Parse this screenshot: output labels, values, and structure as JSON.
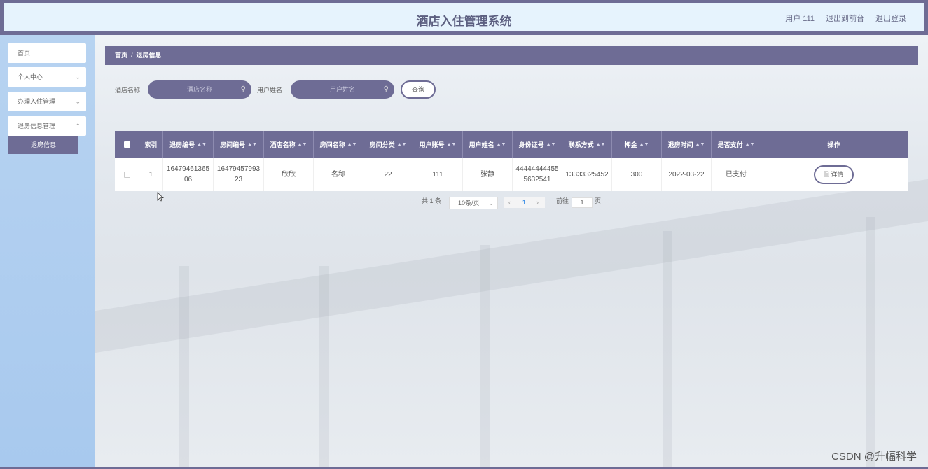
{
  "header": {
    "title": "酒店入住管理系统",
    "user": "用户 111",
    "exit_front": "退出到前台",
    "logout": "退出登录"
  },
  "sidebar": {
    "items": [
      {
        "label": "首页"
      },
      {
        "label": "个人中心"
      },
      {
        "label": "办理入住管理"
      },
      {
        "label": "退房信息管理"
      }
    ],
    "active_sub": "退房信息"
  },
  "breadcrumb": {
    "home": "首页",
    "sep": "/",
    "current": "退房信息"
  },
  "search": {
    "hotel_label": "酒店名称",
    "hotel_placeholder": "酒店名称",
    "user_label": "用户姓名",
    "user_placeholder": "用户姓名",
    "query_button": "查询"
  },
  "table": {
    "headers": [
      "索引",
      "退房编号",
      "房间编号",
      "酒店名称",
      "房间名称",
      "房间分类",
      "用户账号",
      "用户姓名",
      "身份证号",
      "联系方式",
      "押金",
      "退房时间",
      "是否支付",
      "操作"
    ],
    "rows": [
      {
        "index": "1",
        "checkout_no": "1647946136506",
        "room_no": "1647945799323",
        "hotel": "欣欣",
        "room_name": "名称",
        "room_type": "22",
        "account": "111",
        "user_name": "张静",
        "id_no": "444444444555632541",
        "phone": "13333325452",
        "deposit": "300",
        "checkout_time": "2022-03-22",
        "paid": "已支付",
        "action": "详情"
      }
    ]
  },
  "pager": {
    "total": "共 1 条",
    "page_size": "10条/页",
    "current_page": "1",
    "goto_label": "前往",
    "goto_value": "1",
    "page_unit": "页"
  },
  "watermark": "CSDN @升幅科学",
  "colors": {
    "accent": "#6e6c95",
    "header_bg": "#e6f3fd",
    "sidebar_bg": "#b7d3f1"
  }
}
